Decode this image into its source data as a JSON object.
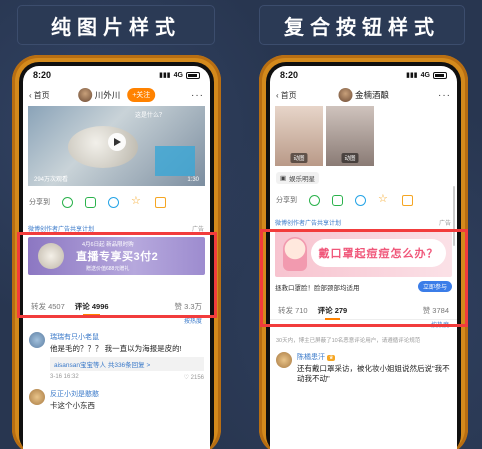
{
  "titles": {
    "left": "纯图片样式",
    "right": "复合按钮样式"
  },
  "left_phone": {
    "status": {
      "time": "8:20",
      "network": "4G"
    },
    "nav": {
      "back": "首页",
      "user": "川外川",
      "follow": "+关注",
      "more": "···"
    },
    "video": {
      "views": "294万次观看",
      "duration": "1:30",
      "caption": "这是什么？"
    },
    "share": {
      "label": "分享到"
    },
    "ad": {
      "header": "微博创作者广告共享计划",
      "ad_label": "广告",
      "banner_line1": "4月6日起 新品限时购",
      "banner_line2": "直播专享买3付2",
      "banner_line3": "赠送价值688元赠礼"
    },
    "tabs": {
      "repost": "转发 4507",
      "comment": "评论 4996",
      "like": "赞 3.3万"
    },
    "sort": "按热度",
    "comments": [
      {
        "name": "瑞瑞有只小老鼠",
        "text": "他是毛的？？？ 我一直以为海报是皮的!",
        "reply": "aisansan宝宝等人 共336条回复 >",
        "meta": "3-16 16:32",
        "likes": "2156"
      },
      {
        "name": "反正小刘是憨憨",
        "text": "卡这个小东西",
        "reply": "",
        "meta": "",
        "likes": ""
      }
    ]
  },
  "right_phone": {
    "status": {
      "time": "8:20",
      "network": "4G"
    },
    "nav": {
      "back": "首页",
      "user": "金楠酒酿",
      "more": "···"
    },
    "photos": [
      {
        "gif": "动图"
      },
      {
        "gif": "动图"
      }
    ],
    "topic": "娱乐明星",
    "ad": {
      "header": "微博创作者广告共享计划",
      "ad_label": "广告",
      "bubble": "戴口罩起痘痘怎么办？",
      "desc": "拯救口罩脸！脸部颈部均适用",
      "button": "立即参与"
    },
    "tabs": {
      "repost": "转发 710",
      "comment": "评论 279",
      "like": "赞 3784"
    },
    "sort": "按热度",
    "notice": "30天内，博主已屏蔽了10名恶意评论用户，请遵循评论规范",
    "comments": [
      {
        "name": "陈橘患汗",
        "text": "还有戴口罩采访，被化妆小姐姐说然后说\"我不动我不动\""
      }
    ]
  }
}
